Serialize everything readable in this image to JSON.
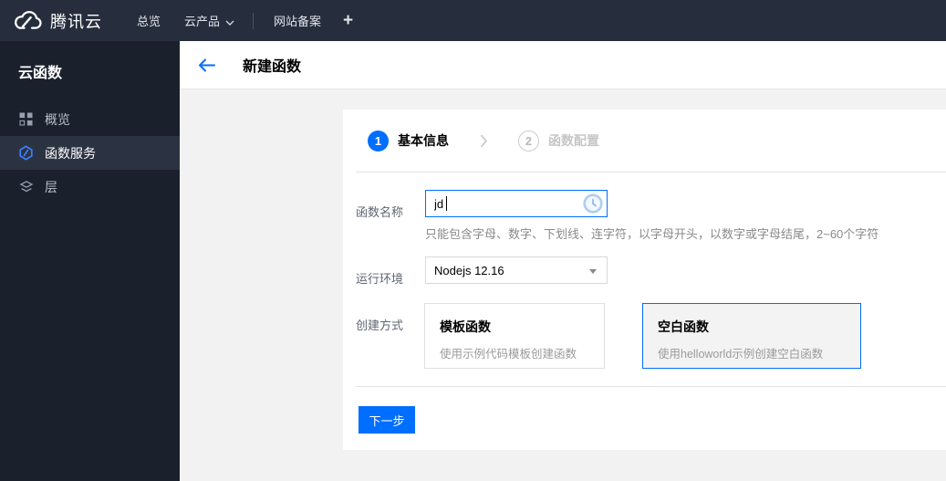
{
  "topbar": {
    "brand": "腾讯云",
    "nav": [
      {
        "label": "总览"
      },
      {
        "label": "云产品"
      },
      {
        "label": "网站备案"
      }
    ],
    "add_label": "+"
  },
  "sidebar": {
    "title": "云函数",
    "items": [
      {
        "label": "概览",
        "icon": "grid-icon",
        "active": false
      },
      {
        "label": "函数服务",
        "icon": "scf-hexagon-icon",
        "active": true
      },
      {
        "label": "层",
        "icon": "layers-icon",
        "active": false
      }
    ]
  },
  "header": {
    "title": "新建函数"
  },
  "steps": [
    {
      "number": "1",
      "label": "基本信息",
      "active": true
    },
    {
      "number": "2",
      "label": "函数配置",
      "active": false
    }
  ],
  "form": {
    "name": {
      "label": "函数名称",
      "value": "jd",
      "helper": "只能包含字母、数字、下划线、连字符，以字母开头，以数字或字母结尾，2~60个字符"
    },
    "runtime": {
      "label": "运行环境",
      "value": "Nodejs 12.16"
    },
    "method": {
      "label": "创建方式",
      "options": [
        {
          "title": "模板函数",
          "desc": "使用示例代码模板创建函数",
          "selected": false
        },
        {
          "title": "空白函数",
          "desc": "使用helloworld示例创建空白函数",
          "selected": true
        }
      ]
    }
  },
  "footer": {
    "next_label": "下一步"
  },
  "colors": {
    "accent": "#006eff",
    "topbar_bg": "#262e3d",
    "sidebar_bg": "#1b212c",
    "sidebar_active_bg": "#2b3342"
  }
}
